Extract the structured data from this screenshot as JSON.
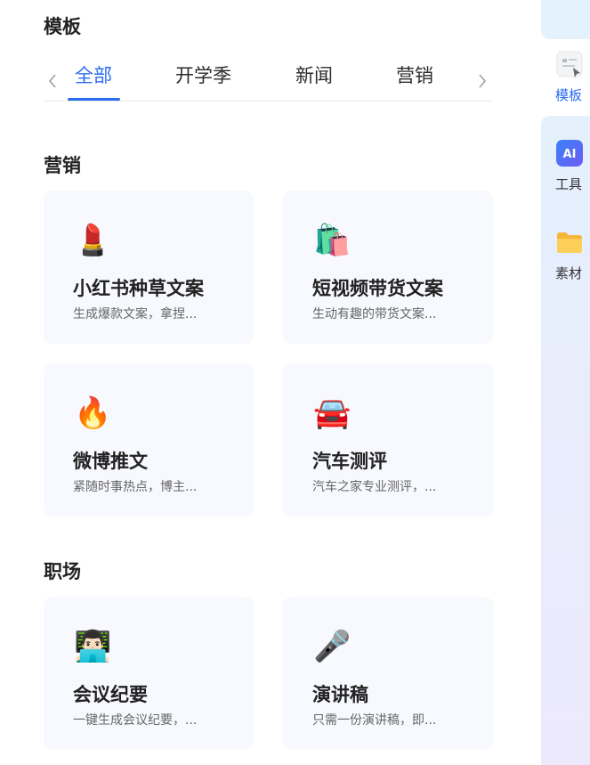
{
  "panel": {
    "title": "模板"
  },
  "tabs": {
    "items": [
      {
        "label": "全部",
        "active": true
      },
      {
        "label": "开学季",
        "active": false
      },
      {
        "label": "新闻",
        "active": false
      },
      {
        "label": "营销",
        "active": false
      }
    ],
    "prev_icon": "chevron-left-icon",
    "next_icon": "chevron-right-icon"
  },
  "sections": [
    {
      "title": "营销",
      "cards": [
        {
          "emoji": "💄",
          "title": "小红书种草文案",
          "desc": "生成爆款文案，拿捏..."
        },
        {
          "emoji": "🛍️",
          "title": "短视频带货文案",
          "desc": "生动有趣的带货文案..."
        },
        {
          "emoji": "🔥",
          "title": "微博推文",
          "desc": "紧随时事热点，博主..."
        },
        {
          "emoji": "🚘",
          "title": "汽车测评",
          "desc": "汽车之家专业测评，..."
        }
      ]
    },
    {
      "title": "职场",
      "cards": [
        {
          "emoji": "👨🏻‍💻",
          "title": "会议纪要",
          "desc": "一键生成会议纪要，..."
        },
        {
          "emoji": "🎤",
          "title": "演讲稿",
          "desc": "只需一份演讲稿，即..."
        }
      ]
    }
  ],
  "rail": {
    "items": [
      {
        "label": "模板",
        "icon": "template-icon",
        "active": true
      },
      {
        "label": "工具",
        "icon": "ai-icon",
        "icon_text": "AI",
        "active": false
      },
      {
        "label": "素材",
        "icon": "folder-icon",
        "active": false
      }
    ]
  },
  "colors": {
    "accent": "#2b6cf0",
    "card_bg": "#f7f9fe",
    "rail_bg": "#e5f0fd"
  }
}
